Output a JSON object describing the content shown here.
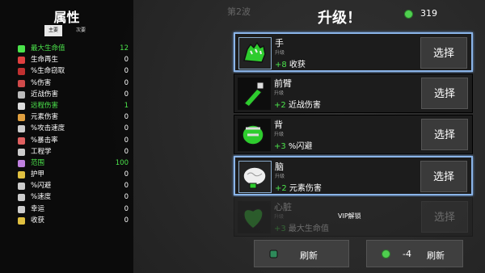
{
  "left": {
    "title": "属性",
    "tab_main": "主要",
    "tab_secondary": "次要",
    "stats": [
      {
        "label": "最大生命值",
        "value": "12",
        "highlight": true,
        "icon": "heart-icon",
        "color": "#4be34b"
      },
      {
        "label": "生命再生",
        "value": "0",
        "highlight": false,
        "icon": "regen-icon",
        "color": "#e04040"
      },
      {
        "label": "%生命窃取",
        "value": "0",
        "highlight": false,
        "icon": "lifesteal-icon",
        "color": "#c03030"
      },
      {
        "label": "%伤害",
        "value": "0",
        "highlight": false,
        "icon": "damage-icon",
        "color": "#d04a4a"
      },
      {
        "label": "近战伤害",
        "value": "0",
        "highlight": false,
        "icon": "melee-icon",
        "color": "#bbbbbb"
      },
      {
        "label": "远程伤害",
        "value": "1",
        "highlight": true,
        "icon": "ranged-icon",
        "color": "#dddddd"
      },
      {
        "label": "元素伤害",
        "value": "0",
        "highlight": false,
        "icon": "elemental-icon",
        "color": "#e0a040"
      },
      {
        "label": "%攻击速度",
        "value": "0",
        "highlight": false,
        "icon": "attack-speed-icon",
        "color": "#cccccc"
      },
      {
        "label": "%暴击率",
        "value": "0",
        "highlight": false,
        "icon": "crit-icon",
        "color": "#e06060"
      },
      {
        "label": "工程学",
        "value": "0",
        "highlight": false,
        "icon": "engineering-icon",
        "color": "#cccccc"
      },
      {
        "label": "范围",
        "value": "100",
        "highlight": true,
        "icon": "range-icon",
        "color": "#c080e0"
      },
      {
        "label": "护甲",
        "value": "0",
        "highlight": false,
        "icon": "armor-icon",
        "color": "#e0c040"
      },
      {
        "label": "%闪避",
        "value": "0",
        "highlight": false,
        "icon": "dodge-icon",
        "color": "#cccccc"
      },
      {
        "label": "%速度",
        "value": "0",
        "highlight": false,
        "icon": "speed-icon",
        "color": "#cccccc"
      },
      {
        "label": "幸运",
        "value": "0",
        "highlight": false,
        "icon": "luck-icon",
        "color": "#cccccc"
      },
      {
        "label": "收获",
        "value": "0",
        "highlight": false,
        "icon": "harvest-icon",
        "color": "#e0c040"
      }
    ]
  },
  "header": {
    "wave": "第2波",
    "title": "升级！",
    "coins": "319"
  },
  "cards": [
    {
      "name": "手",
      "sub": "升级",
      "plus": "+8",
      "effect": " 收获",
      "button": "选择",
      "selected": true,
      "dim": false,
      "icon": "hand-icon"
    },
    {
      "name": "前臂",
      "sub": "升级",
      "plus": "+2",
      "effect": " 近战伤害",
      "button": "选择",
      "selected": false,
      "dim": false,
      "icon": "forearm-icon"
    },
    {
      "name": "背",
      "sub": "升级",
      "plus": "+3",
      "effect": " %闪避",
      "button": "选择",
      "selected": false,
      "dim": false,
      "icon": "back-icon"
    },
    {
      "name": "脑",
      "sub": "升级",
      "plus": "+2",
      "effect": " 元素伤害",
      "button": "选择",
      "selected": true,
      "dim": false,
      "icon": "brain-icon"
    },
    {
      "name": "心脏",
      "sub": "升级",
      "plus": "+3",
      "effect": " 最大生命值",
      "button": "选择",
      "selected": false,
      "dim": true,
      "icon": "heart-organ-icon"
    }
  ],
  "vip_label": "VIP解锁",
  "footer": {
    "refresh_label": "刷新",
    "refresh_cost": "-4",
    "refresh_cost_label": "刷新"
  },
  "colors": {
    "accent_green": "#4be34b",
    "selected_border": "#8ab4e8"
  }
}
